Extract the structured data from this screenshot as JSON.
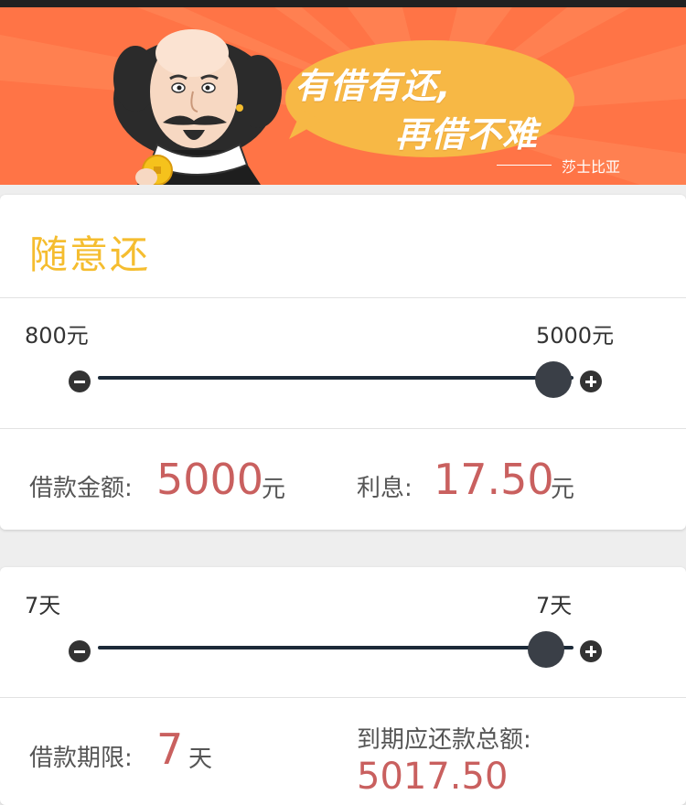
{
  "banner": {
    "slogan_line1": "有借有还,",
    "slogan_line2": "再借不难",
    "attribution": "莎士比亚",
    "colors": {
      "background": "#ff7446",
      "bubble": "#f7b845"
    }
  },
  "repay_card": {
    "title": "随意还",
    "amount_slider": {
      "min_label": "800元",
      "max_label": "5000元",
      "min": 800,
      "max": 5000,
      "value": 5000
    },
    "loan_amount_label": "借款金额:",
    "loan_amount_value": "5000",
    "loan_amount_unit": "元",
    "interest_label": "利息:",
    "interest_value": "17.50",
    "interest_unit": "元"
  },
  "term_card": {
    "term_slider": {
      "min_label": "7天",
      "max_label": "7天",
      "min": 7,
      "max": 7,
      "value": 7
    },
    "term_label": "借款期限:",
    "term_value": "7",
    "term_unit": "天",
    "total_label": "到期应还款总额:",
    "total_value": "5017.50"
  },
  "icons": {
    "decrease": "minus-circle-icon",
    "increase": "plus-circle-icon"
  },
  "colors": {
    "accent_title": "#f5bd2f",
    "value_red": "#c9605f",
    "track": "#1c2a38"
  }
}
